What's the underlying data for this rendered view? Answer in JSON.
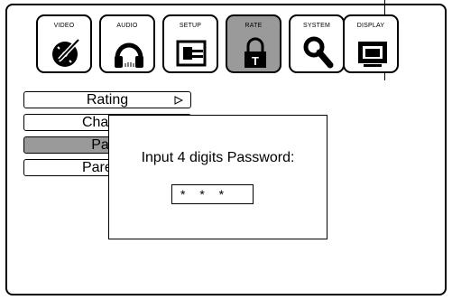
{
  "tabs": [
    {
      "label": "VIDEO",
      "icon": "video-disc-icon"
    },
    {
      "label": "AUDIO",
      "icon": "headphones-icon"
    },
    {
      "label": "SETUP",
      "icon": "setup-plug-icon"
    },
    {
      "label": "RATE",
      "icon": "padlock-icon",
      "active": true
    },
    {
      "label": "SYSTEM",
      "icon": "magnifier-icon"
    },
    {
      "label": "DISPLAY",
      "icon": "monitor-icon"
    }
  ],
  "menu": {
    "items": [
      {
        "label": "Rating",
        "has_submenu": true
      },
      {
        "label": "Channe"
      },
      {
        "label": "Pass",
        "selected": true
      },
      {
        "label": "Parenta"
      }
    ]
  },
  "dialog": {
    "prompt": "Input 4 digits Password:",
    "password_value": "* * *"
  },
  "colors": {
    "active_tab": "#9a9a9a",
    "selected_item": "#9a9a9a",
    "border": "#000000"
  }
}
